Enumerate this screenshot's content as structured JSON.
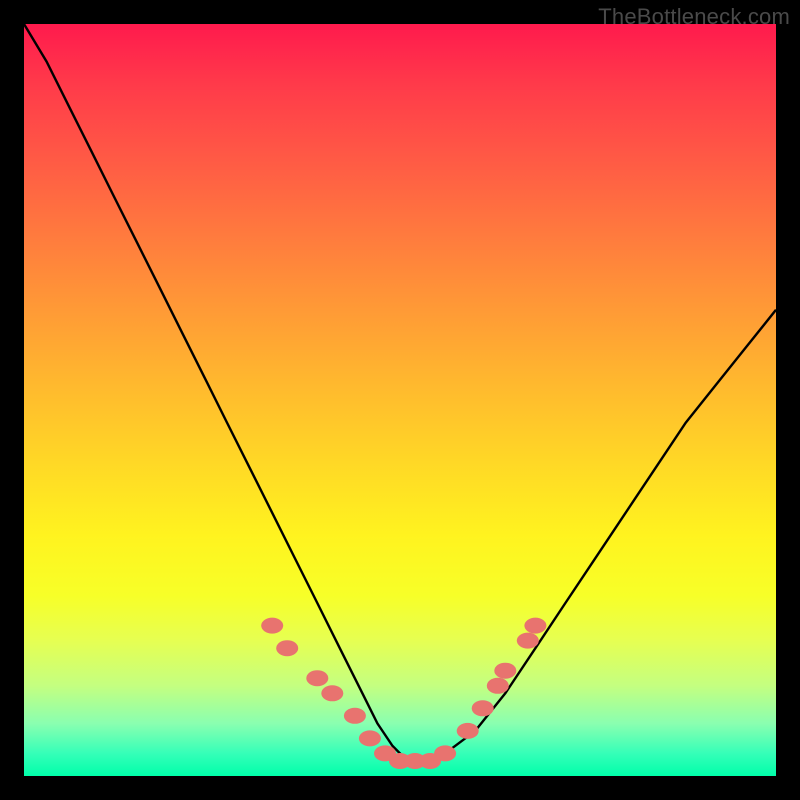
{
  "watermark": "TheBottleneck.com",
  "chart_data": {
    "type": "line",
    "title": "",
    "xlabel": "",
    "ylabel": "",
    "xlim": [
      0,
      100
    ],
    "ylim": [
      0,
      100
    ],
    "series": [
      {
        "name": "bottleneck-curve",
        "x": [
          0,
          3,
          6,
          9,
          12,
          15,
          18,
          21,
          24,
          27,
          30,
          33,
          36,
          39,
          42,
          45,
          47,
          49,
          51,
          53,
          56,
          60,
          64,
          68,
          72,
          76,
          80,
          84,
          88,
          92,
          96,
          100
        ],
        "y": [
          100,
          95,
          89,
          83,
          77,
          71,
          65,
          59,
          53,
          47,
          41,
          35,
          29,
          23,
          17,
          11,
          7,
          4,
          2,
          2,
          3,
          6,
          11,
          17,
          23,
          29,
          35,
          41,
          47,
          52,
          57,
          62
        ]
      }
    ],
    "highlight_points": {
      "name": "marker-dots",
      "points": [
        {
          "x": 33,
          "y": 20
        },
        {
          "x": 35,
          "y": 17
        },
        {
          "x": 39,
          "y": 13
        },
        {
          "x": 41,
          "y": 11
        },
        {
          "x": 44,
          "y": 8
        },
        {
          "x": 46,
          "y": 5
        },
        {
          "x": 48,
          "y": 3
        },
        {
          "x": 50,
          "y": 2
        },
        {
          "x": 52,
          "y": 2
        },
        {
          "x": 54,
          "y": 2
        },
        {
          "x": 56,
          "y": 3
        },
        {
          "x": 59,
          "y": 6
        },
        {
          "x": 61,
          "y": 9
        },
        {
          "x": 63,
          "y": 12
        },
        {
          "x": 64,
          "y": 14
        },
        {
          "x": 67,
          "y": 18
        },
        {
          "x": 68,
          "y": 20
        }
      ]
    },
    "gradient_stops": [
      {
        "pos": 0,
        "color": "#ff1a4d"
      },
      {
        "pos": 50,
        "color": "#ffd726"
      },
      {
        "pos": 80,
        "color": "#fff31f"
      },
      {
        "pos": 100,
        "color": "#00ffaa"
      }
    ]
  }
}
